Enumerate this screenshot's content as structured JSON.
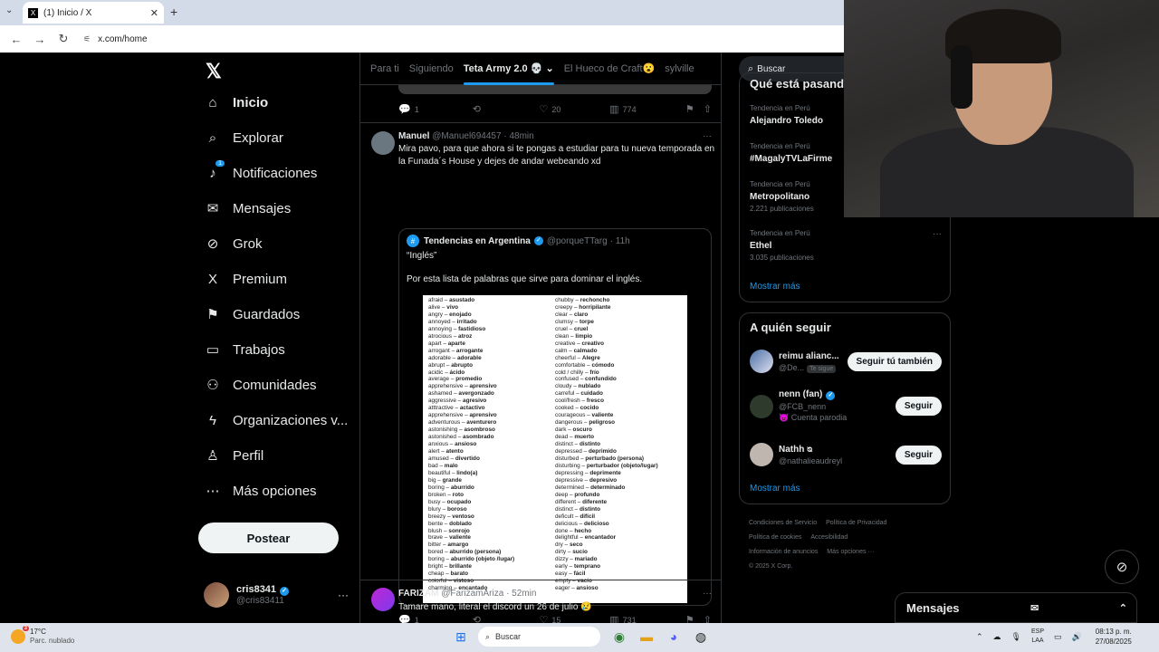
{
  "browser": {
    "tab_title": "(1) Inicio / X",
    "url": "x.com/home"
  },
  "sidebar": {
    "items": [
      {
        "label": "Inicio",
        "icon": "home-icon",
        "glyph": "⌂"
      },
      {
        "label": "Explorar",
        "icon": "search-icon",
        "glyph": "⌕"
      },
      {
        "label": "Notificaciones",
        "icon": "bell-icon",
        "glyph": "♪",
        "badge": "1"
      },
      {
        "label": "Mensajes",
        "icon": "mail-icon",
        "glyph": "✉"
      },
      {
        "label": "Grok",
        "icon": "grok-icon",
        "glyph": "⊘"
      },
      {
        "label": "Premium",
        "icon": "x-premium-icon",
        "glyph": "X"
      },
      {
        "label": "Guardados",
        "icon": "bookmark-icon",
        "glyph": "⚑"
      },
      {
        "label": "Trabajos",
        "icon": "briefcase-icon",
        "glyph": "▭"
      },
      {
        "label": "Comunidades",
        "icon": "people-icon",
        "glyph": "⚇"
      },
      {
        "label": "Organizaciones v...",
        "icon": "lightning-icon",
        "glyph": "ϟ"
      },
      {
        "label": "Perfil",
        "icon": "person-icon",
        "glyph": "♙"
      },
      {
        "label": "Más opciones",
        "icon": "more-circle-icon",
        "glyph": "⋯"
      }
    ],
    "post_button": "Postear",
    "account": {
      "name": "cris8341",
      "handle": "@cris83411"
    }
  },
  "feed_tabs": [
    "Para ti",
    "Siguiendo",
    "Teta Army 2.0 💀",
    "El Hueco de Craft😮",
    "sylville"
  ],
  "post0_actions": {
    "replies": "1",
    "likes": "20",
    "views": "774"
  },
  "post1": {
    "name": "Manuel",
    "handle": "@Manuel694457",
    "time": "· 48min",
    "text": "Mira pavo, para que ahora si te pongas a estudiar para tu nueva temporada en la Funada´s House y dejes de andar webeando xd",
    "quote": {
      "name": "Tendencias en Argentina",
      "handle": "@porqueTTarg",
      "time": "· 11h",
      "title": "“Inglés”",
      "text": "Por esta lista de palabras que sirve para dominar el inglés."
    },
    "actions": {
      "replies": "1",
      "likes": "15",
      "views": "731"
    }
  },
  "post2": {
    "name": "FARIZAM",
    "handle": "@FarizamAriza",
    "time": "· 52min",
    "text": "Tamare mano, literal el discord un 26 de julio 😢"
  },
  "vocab_left": [
    [
      "afraid",
      "asustado"
    ],
    [
      "alive",
      "vivo"
    ],
    [
      "angry",
      "enojado"
    ],
    [
      "annoyed",
      "irritado"
    ],
    [
      "annoying",
      "fastidioso"
    ],
    [
      "atrocious",
      "atroz"
    ],
    [
      "apart",
      "aparte"
    ],
    [
      "arrogant",
      "arrogante"
    ],
    [
      "adorable",
      "adorable"
    ],
    [
      "abrupt",
      "abrupto"
    ],
    [
      "acidic",
      "ácido"
    ],
    [
      "average",
      "promedio"
    ],
    [
      "apprehensive",
      "aprensivo"
    ],
    [
      "ashamed",
      "avergonzado"
    ],
    [
      "aggressive",
      "agresivo"
    ],
    [
      "atttractive",
      "actactivo"
    ],
    [
      "apprehensive",
      "aprensivo"
    ],
    [
      "adventurous",
      "aventurero"
    ],
    [
      "astonishing",
      "asombroso"
    ],
    [
      "astonished",
      "asombrado"
    ],
    [
      "anxious",
      "ansioso"
    ],
    [
      "alert",
      "atento"
    ],
    [
      "amused",
      "divertido"
    ],
    [
      "bad",
      "malo"
    ],
    [
      "beautiful",
      "lindo(a)"
    ],
    [
      "big",
      "grande"
    ],
    [
      "boring",
      "aburrido"
    ],
    [
      "broken",
      "roto"
    ],
    [
      "busy",
      "ocupado"
    ],
    [
      "blury",
      "boroso"
    ],
    [
      "breezy",
      "ventoso"
    ],
    [
      "bente",
      "doblado"
    ],
    [
      "blush",
      "sonrojo"
    ],
    [
      "brave",
      "valiente"
    ],
    [
      "bitter",
      "amargo"
    ],
    [
      "bored",
      "aburrido (persona)"
    ],
    [
      "boring",
      "aburrido (objeto /lugar)"
    ],
    [
      "bright",
      "brillante"
    ],
    [
      "cheap",
      "barato"
    ],
    [
      "colorful",
      "vistoso"
    ],
    [
      "charming",
      "encantado"
    ]
  ],
  "vocab_right": [
    [
      "chubby",
      "rechoncho"
    ],
    [
      "creepy",
      "horripilante"
    ],
    [
      "clear",
      "claro"
    ],
    [
      "clumsy",
      "torpe"
    ],
    [
      "cruel",
      "cruel"
    ],
    [
      "clean",
      "limpio"
    ],
    [
      "creative",
      "creativo"
    ],
    [
      "calm",
      "calmado"
    ],
    [
      "cheerful",
      "Alegre"
    ],
    [
      "comfortable",
      "cómodo"
    ],
    [
      "cold / chilly",
      "frío"
    ],
    [
      "confused",
      "confundido"
    ],
    [
      "cloudy",
      "nublado"
    ],
    [
      "carreful",
      "cuidado"
    ],
    [
      "cool/fresh",
      "fresco"
    ],
    [
      "cooked",
      "cocido"
    ],
    [
      "courageous",
      "valiente"
    ],
    [
      "dangerous",
      "peligroso"
    ],
    [
      "dark",
      "oscuro"
    ],
    [
      "dead",
      "muerto"
    ],
    [
      "distinct",
      "distinto"
    ],
    [
      "depressed",
      "deprimido"
    ],
    [
      "disturbed",
      "perturbado (persona)"
    ],
    [
      "disturbing",
      "perturbador (objeto/lugar)"
    ],
    [
      "depressing",
      "deprimente"
    ],
    [
      "depressive",
      "depresivo"
    ],
    [
      "determined",
      "determinado"
    ],
    [
      "deep",
      "profundo"
    ],
    [
      "different",
      "diferente"
    ],
    [
      "distinct",
      "distinto"
    ],
    [
      "deficult",
      "difícil"
    ],
    [
      "delicious",
      "delicioso"
    ],
    [
      "done",
      "hecho"
    ],
    [
      "delightful",
      "encantador"
    ],
    [
      "dry",
      "seco"
    ],
    [
      "dirty",
      "sucio"
    ],
    [
      "dizzy",
      "mariado"
    ],
    [
      "early",
      "temprano"
    ],
    [
      "easy",
      "fácil"
    ],
    [
      "empty",
      "vacío"
    ],
    [
      "eager",
      "ansioso"
    ]
  ],
  "right": {
    "search_placeholder": "Buscar",
    "trends_header": "Qué está pasando",
    "trends": [
      {
        "label": "Tendencia en Perú",
        "title": "Alejandro Toledo",
        "count": ""
      },
      {
        "label": "Tendencia en Perú",
        "title": "#MagalyTVLaFirme",
        "count": ""
      },
      {
        "label": "Tendencia en Perú",
        "title": "Metropolitano",
        "count": "2.221 publicaciones"
      },
      {
        "label": "Tendencia en Perú",
        "title": "Ethel",
        "count": "3.035 publicaciones"
      }
    ],
    "show_more": "Mostrar más",
    "who_title": "A quién seguir",
    "who": [
      {
        "name": "reimu alianc...",
        "handle": "@De...",
        "tag": "Te sigue",
        "button": "Seguir tú también",
        "extra": ""
      },
      {
        "name": "nenn (fan)",
        "handle": "@FCB_nenn",
        "tag": "",
        "button": "Seguir",
        "extra": "😈 Cuenta parodia"
      },
      {
        "name": "Nathh ᴓ",
        "handle": "@nathalieaudreyl",
        "tag": "",
        "button": "Seguir",
        "extra": ""
      }
    ],
    "who_more": "Mostrar más",
    "footer": [
      "Condiciones de Servicio",
      "Política de Privacidad",
      "Política de cookies",
      "Accesibilidad",
      "Información de anuncios",
      "Más opciones ···",
      "© 2025 X Corp."
    ]
  },
  "messages_label": "Mensajes",
  "taskbar": {
    "temp": "17°C",
    "weather": "Parc. nublado",
    "search": "Buscar",
    "lang1": "ESP",
    "lang2": "LAA",
    "time": "08:13 p. m.",
    "date": "27/08/2025"
  }
}
